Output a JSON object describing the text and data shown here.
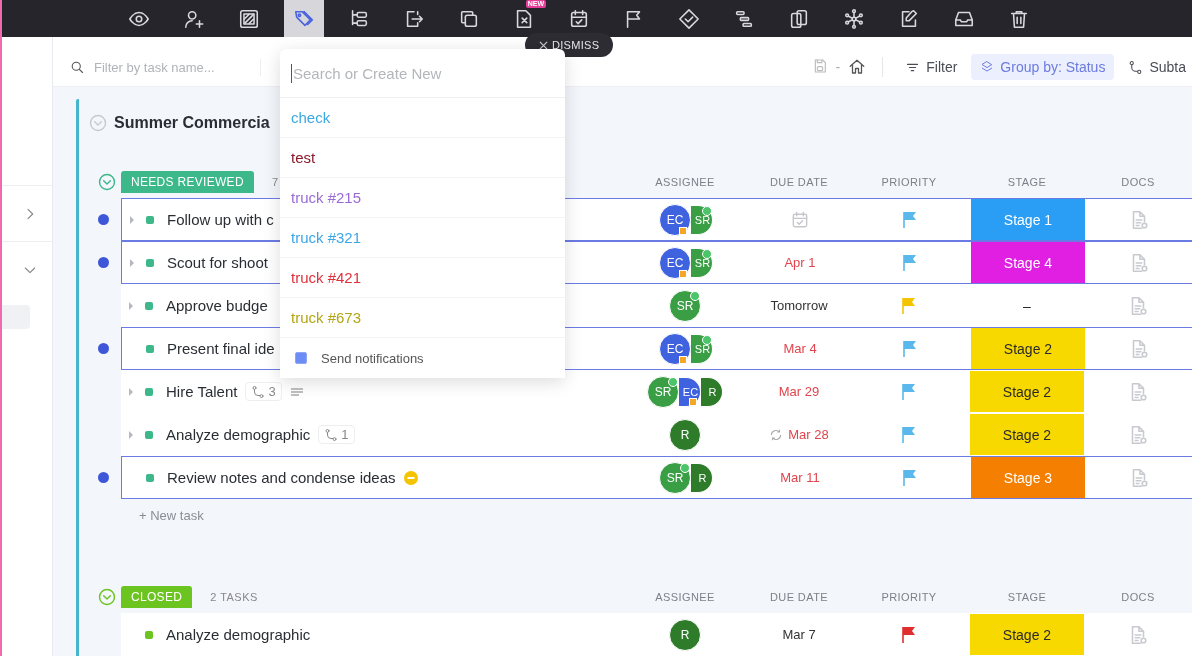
{
  "toolbar": {
    "buttons": [
      {
        "selected": false
      },
      {
        "selected": false
      },
      {
        "selected": false
      },
      {
        "selected": true
      },
      {
        "selected": false
      },
      {
        "selected": false
      },
      {
        "selected": false
      },
      {
        "selected": false,
        "badge": "NEW"
      },
      {
        "selected": false
      },
      {
        "selected": false
      },
      {
        "selected": false
      },
      {
        "selected": false
      },
      {
        "selected": false
      },
      {
        "selected": false
      },
      {
        "selected": false
      },
      {
        "selected": false
      },
      {
        "selected": false
      }
    ]
  },
  "dismiss": {
    "label": "DISMISS"
  },
  "filter_bar": {
    "search": {
      "placeholder": "Filter by task name..."
    },
    "separator": "-",
    "filter": "Filter",
    "group_by": {
      "label": "Group by: Status",
      "selected": true
    },
    "subtasks": "Subta"
  },
  "list": {
    "title": "Summer Commercia",
    "groups": [
      {
        "status": "NEEDS REVIEWED",
        "color": "#3db88a",
        "count": "7",
        "columns": [
          "ASSIGNEE",
          "DUE DATE",
          "PRIORITY",
          "STAGE",
          "DOCS"
        ],
        "new_task": "+ New task",
        "tasks": [
          {
            "name": "Follow up with c",
            "selected": true,
            "expandable": true,
            "assignees": [
              {
                "initials": "EC",
                "color": "#3f62df",
                "online": false,
                "badge": true
              },
              {
                "initials": "SR",
                "color": "#3a9e45",
                "online": true,
                "badge": false
              }
            ],
            "priority": {
              "color": "#5ab8ec"
            },
            "stage": {
              "label": "Stage 1",
              "color": "#2a9df4"
            }
          },
          {
            "name": "Scout for shoot",
            "selected": true,
            "expandable": true,
            "assignees": [
              {
                "initials": "EC",
                "color": "#3f62df",
                "online": false,
                "badge": true
              },
              {
                "initials": "SR",
                "color": "#3a9e45",
                "online": true,
                "badge": false
              }
            ],
            "due": {
              "text": "Apr 1",
              "overdue": true,
              "recurring": false
            },
            "priority": {
              "color": "#5ab8ec"
            },
            "stage": {
              "label": "Stage 4",
              "color": "#e01fe3"
            }
          },
          {
            "name": "Approve budge",
            "selected": false,
            "expandable": true,
            "assignees": [
              {
                "initials": "SR",
                "color": "#3a9e45",
                "online": true,
                "badge": false
              }
            ],
            "due": {
              "text": "Tomorrow",
              "overdue": false,
              "recurring": false
            },
            "priority": {
              "color": "#f5c400"
            },
            "stage": {
              "label": "–"
            }
          },
          {
            "name": "Present final ide",
            "selected": true,
            "expandable": false,
            "assignees": [
              {
                "initials": "EC",
                "color": "#3f62df",
                "online": false,
                "badge": true
              },
              {
                "initials": "SR",
                "color": "#3a9e45",
                "online": true,
                "badge": false
              }
            ],
            "due": {
              "text": "Mar 4",
              "overdue": true,
              "recurring": false
            },
            "priority": {
              "color": "#5ab8ec"
            },
            "stage": {
              "label": "Stage 2",
              "color": "#f7d900"
            }
          },
          {
            "name": "Hire Talent",
            "selected": false,
            "expandable": true,
            "subtasks": "3",
            "has_description": true,
            "assignees": [
              {
                "initials": "SR",
                "color": "#3a9e45",
                "online": true,
                "badge": false
              },
              {
                "initials": "EC",
                "color": "#3f62df",
                "online": false,
                "badge": true
              },
              {
                "initials": "R",
                "color": "#2e7b2a",
                "online": false,
                "badge": false
              }
            ],
            "due": {
              "text": "Mar 29",
              "overdue": true,
              "recurring": false
            },
            "priority": {
              "color": "#5ab8ec"
            },
            "stage": {
              "label": "Stage 2",
              "color": "#f7d900"
            }
          },
          {
            "name": "Analyze demographic",
            "selected": false,
            "expandable": true,
            "subtasks": "1",
            "assignees": [
              {
                "initials": "R",
                "color": "#2e7b2a",
                "online": false,
                "badge": false
              }
            ],
            "due": {
              "text": "Mar 28",
              "overdue": true,
              "recurring": true
            },
            "priority": {
              "color": "#5ab8ec"
            },
            "stage": {
              "label": "Stage 2",
              "color": "#f7d900"
            }
          },
          {
            "name": "Review notes and condense ideas",
            "selected": true,
            "expandable": false,
            "blocked": true,
            "assignees": [
              {
                "initials": "SR",
                "color": "#3a9e45",
                "online": true,
                "badge": false
              },
              {
                "initials": "R",
                "color": "#2e7b2a",
                "online": false,
                "badge": false
              }
            ],
            "due": {
              "text": "Mar 11",
              "overdue": true,
              "recurring": false
            },
            "priority": {
              "color": "#5ab8ec"
            },
            "stage": {
              "label": "Stage 3",
              "color": "#f47f00"
            }
          }
        ]
      },
      {
        "status": "CLOSED",
        "color": "#6bc41f",
        "count": "2 TASKS",
        "columns": [
          "ASSIGNEE",
          "DUE DATE",
          "PRIORITY",
          "STAGE",
          "DOCS"
        ],
        "tasks": [
          {
            "name": "Analyze demographic",
            "selected": false,
            "expandable": false,
            "assignees": [
              {
                "initials": "R",
                "color": "#2e7b2a",
                "online": false,
                "badge": false
              }
            ],
            "due": {
              "text": "Mar 7",
              "overdue": false,
              "recurring": false
            },
            "priority": {
              "color": "#e02d2d"
            },
            "stage": {
              "label": "Stage 2",
              "color": "#f7d900"
            }
          }
        ]
      }
    ]
  },
  "dropdown": {
    "placeholder": "Search or Create New",
    "options": [
      {
        "label": "check",
        "color": "#3ba8e0"
      },
      {
        "label": "test",
        "color": "#8b1a2b"
      },
      {
        "label": "truck #215",
        "color": "#9a6bd6"
      },
      {
        "label": "truck #321",
        "color": "#3aa6e8"
      },
      {
        "label": "truck #421",
        "color": "#e0303c"
      },
      {
        "label": "truck #673",
        "color": "#b3a514"
      }
    ],
    "notify": {
      "label": "Send notifications",
      "checked": true
    }
  }
}
